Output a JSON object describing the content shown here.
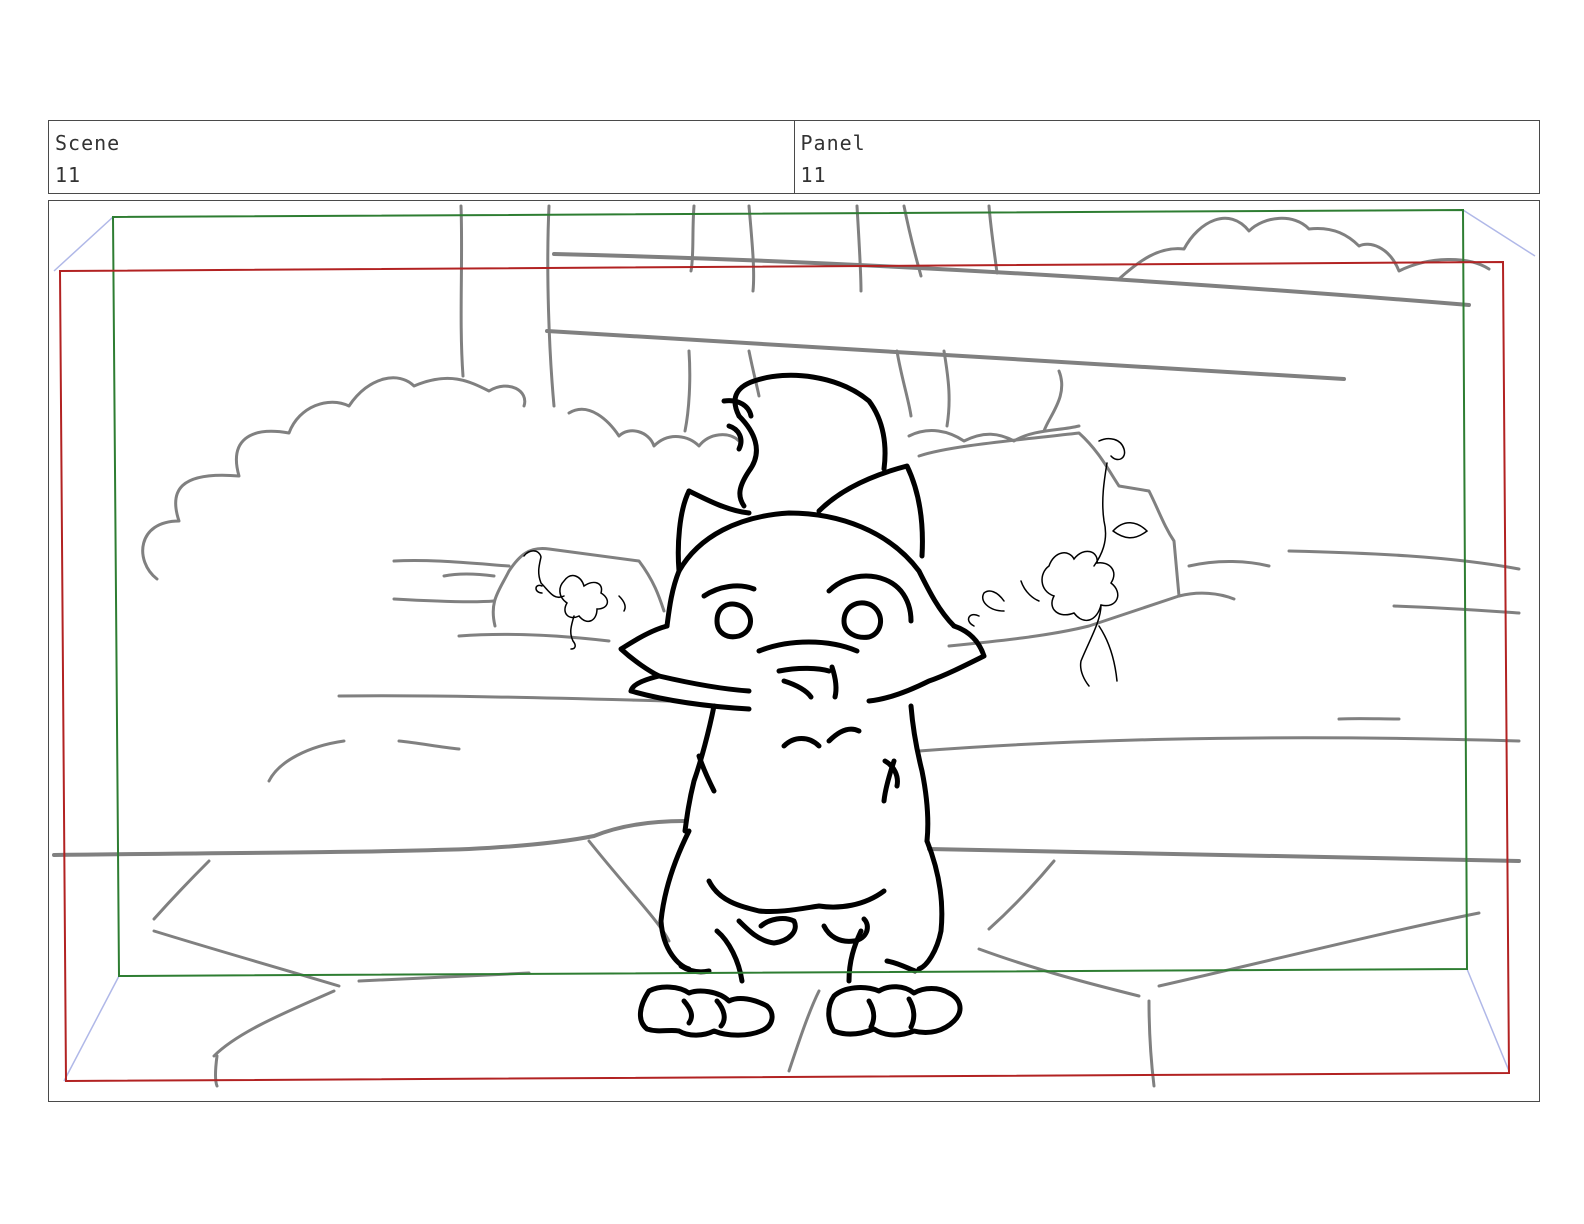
{
  "header": {
    "scene_label": "Scene",
    "scene_value": "11",
    "panel_label": "Panel",
    "panel_value": "11"
  },
  "frame_colors": {
    "safe_area": "#2e7d32",
    "camera_field": "#b22222",
    "bg_sketch": "#808080",
    "character_ink": "#000000",
    "perspective_guides": "#b0b8e8"
  }
}
